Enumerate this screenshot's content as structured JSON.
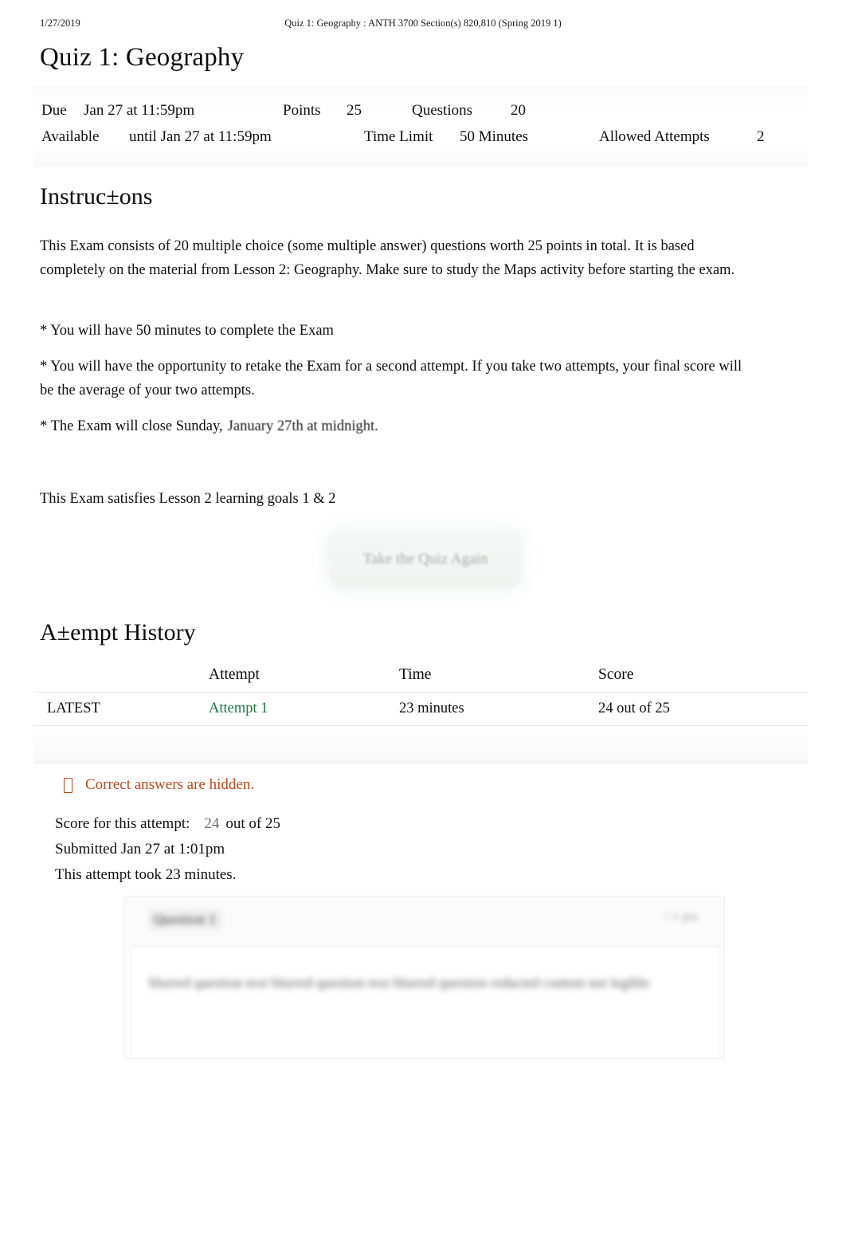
{
  "print_header": {
    "date": "1/27/2019",
    "title": "Quiz 1: Geography : ANTH 3700 Section(s) 820,810 (Spring 2019 1)"
  },
  "quiz": {
    "title": "Quiz 1: Geography"
  },
  "details": {
    "due_label": "Due",
    "due_value": "Jan 27 at 11:59pm",
    "points_label": "Points",
    "points_value": "25",
    "questions_label": "Questions",
    "questions_value": "20",
    "available_label": "Available",
    "available_value": "until Jan 27 at 11:59pm",
    "time_limit_label": "Time Limit",
    "time_limit_value": "50 Minutes",
    "allowed_attempts_label": "Allowed Attempts",
    "allowed_attempts_value": "2"
  },
  "instructions": {
    "heading": "Instruc±ons",
    "paragraph_1": "This Exam consists of 20 multiple choice (some multiple answer) questions worth 25 points in total. It is based completely on the material from Lesson 2: Geography. Make sure to study the Maps activity before starting the exam.",
    "paragraph_2": "* You will have 50 minutes to complete the Exam",
    "paragraph_3": "* You will have the opportunity to retake the Exam for a second attempt. If you take two attempts, your final score will be the average of your two attempts.",
    "paragraph_4_prefix": "* The Exam will close Sunday,",
    "paragraph_4_highlight": "January 27th at midnight.",
    "paragraph_5": "This Exam satisfies Lesson 2 learning goals 1 & 2"
  },
  "actions": {
    "retake_label": "Take the Quiz Again"
  },
  "attempt_history": {
    "heading": "A±empt History",
    "columns": [
      "",
      "Attempt",
      "Time",
      "Score"
    ],
    "rows": [
      {
        "kind": "LATEST",
        "attempt": "Attempt 1",
        "time": "23 minutes",
        "score": "24 out of 25"
      }
    ]
  },
  "notice": {
    "icon": "missing-glyph-box",
    "text": "Correct answers are hidden.",
    "color": "#c0451c"
  },
  "score_summary": {
    "score_label": "Score for this attempt:",
    "score_value": "24",
    "score_suffix": "out of 25",
    "submitted": "Submitted Jan 27 at 1:01pm",
    "duration": "This attempt took 23 minutes."
  },
  "question_card": {
    "label": "Question 1",
    "points": "/ 1 pts",
    "text": "blurred question text blurred question text blurred question redacted content not legible"
  },
  "colors": {
    "link_green": "#1a7a42",
    "notice_orange": "#c0451c",
    "body_text": "#101010"
  }
}
